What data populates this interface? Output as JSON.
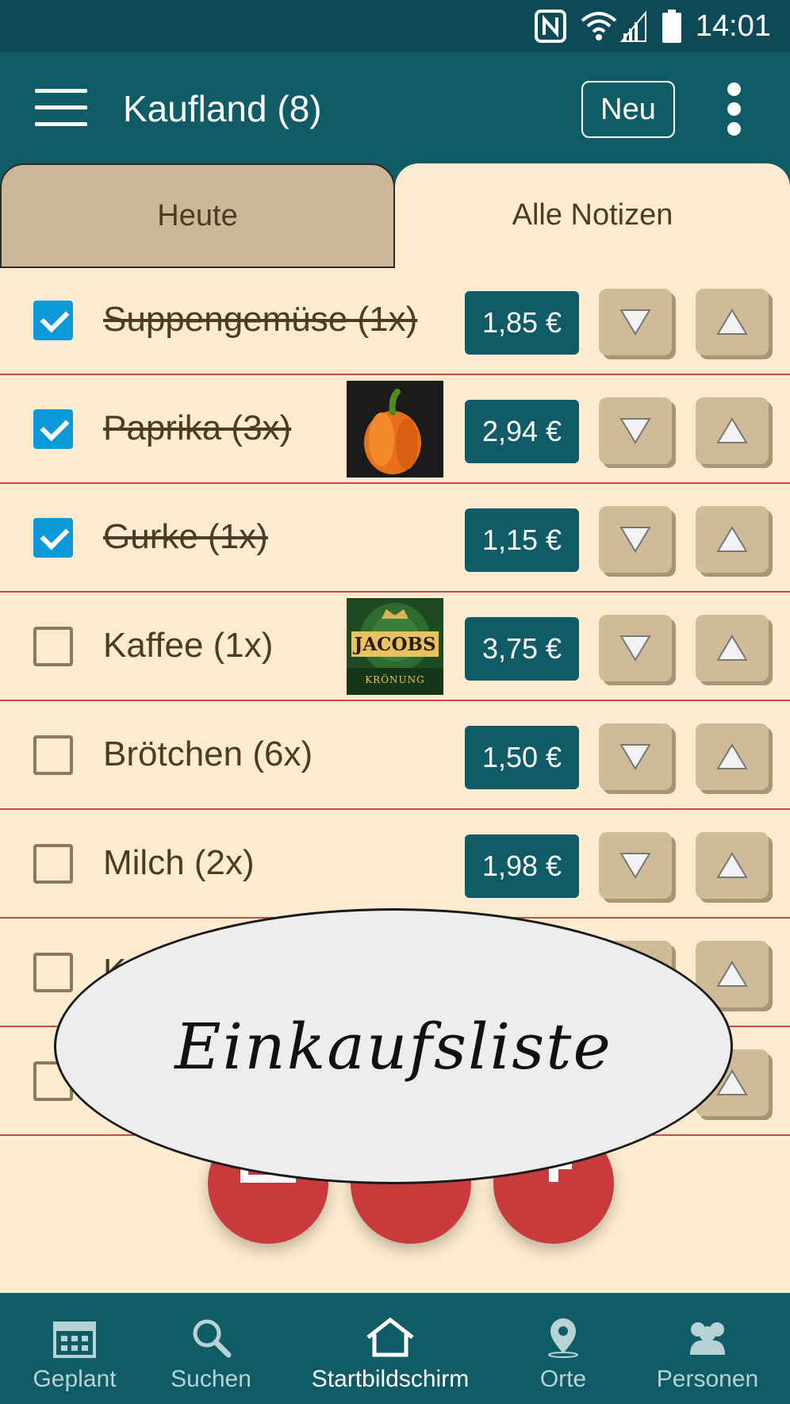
{
  "status_bar": {
    "time": "14:01"
  },
  "app_bar": {
    "title": "Kaufland (8)",
    "new_label": "Neu"
  },
  "tabs": [
    {
      "label": "Heute",
      "active": false
    },
    {
      "label": "Alle Notizen",
      "active": true
    }
  ],
  "items": [
    {
      "label": "Suppengemüse (1x)",
      "checked": true,
      "price": "1,85 €"
    },
    {
      "label": "Paprika (3x)",
      "checked": true,
      "price": "2,94 €"
    },
    {
      "label": "Gurke (1x)",
      "checked": true,
      "price": "1,15 €"
    },
    {
      "label": "Kaffee (1x)",
      "checked": false,
      "price": "3,75 €"
    },
    {
      "label": "Brötchen (6x)",
      "checked": false,
      "price": "1,50 €"
    },
    {
      "label": "Milch (2x)",
      "checked": false,
      "price": "1,98 €"
    },
    {
      "label": "K",
      "checked": false
    },
    {
      "label": "",
      "checked": false
    }
  ],
  "jacobs_logo": {
    "brand": "JACOBS",
    "line": "KRÖNUNG"
  },
  "overlay": {
    "text": "Einkaufsliste"
  },
  "bottom_nav": [
    {
      "label": "Geplant",
      "icon": "calendar-icon"
    },
    {
      "label": "Suchen",
      "icon": "search-icon"
    },
    {
      "label": "Startbildschirm",
      "icon": "home-icon",
      "active": true
    },
    {
      "label": "Orte",
      "icon": "location-icon"
    },
    {
      "label": "Personen",
      "icon": "people-icon"
    }
  ],
  "colors": {
    "header": "#0f5c66",
    "status": "#0c4b55",
    "page": "#fdebd0",
    "tab_inactive": "#cbb898",
    "fab": "#c83a3c",
    "checkbox": "#0e9ad8"
  }
}
